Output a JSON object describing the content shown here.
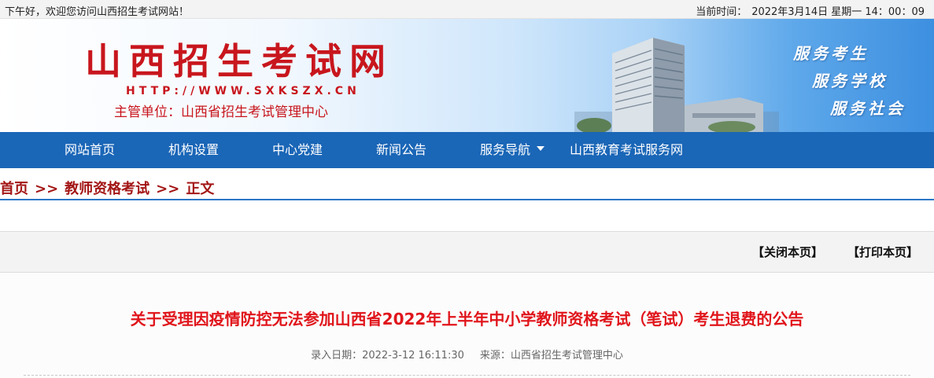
{
  "topbar": {
    "greeting": "下午好，欢迎您访问山西招生考试网站！",
    "time_label": "当前时间：",
    "time_value": "2022年3月14日 星期一 14：00：09"
  },
  "banner": {
    "title": "山西招生考试网",
    "url": "HTTP://WWW.SXKSZX.CN",
    "subtitle": "主管单位：山西省招生考试管理中心",
    "slogans": [
      "服务考生",
      "服务学校",
      "服务社会"
    ]
  },
  "nav": {
    "items": [
      {
        "label": "网站首页"
      },
      {
        "label": "机构设置"
      },
      {
        "label": "中心党建"
      },
      {
        "label": "新闻公告"
      },
      {
        "label": "服务导航"
      },
      {
        "label": "山西教育考试服务网"
      }
    ]
  },
  "breadcrumb": {
    "items": [
      "首页",
      "教师资格考试",
      "正文"
    ],
    "separator": ">>"
  },
  "toolbar": {
    "close_label": "【关闭本页】",
    "print_label": "【打印本页】"
  },
  "article": {
    "title": "关于受理因疫情防控无法参加山西省2022年上半年中小学教师资格考试（笔试）考生退费的公告",
    "date_label": "录入日期：2022-3-12 16:11:30",
    "source_label": "来源：山西省招生考试管理中心"
  },
  "colors": {
    "brand_red": "#c8161d",
    "nav_blue": "#1a66b7",
    "title_red": "#e0151b"
  }
}
